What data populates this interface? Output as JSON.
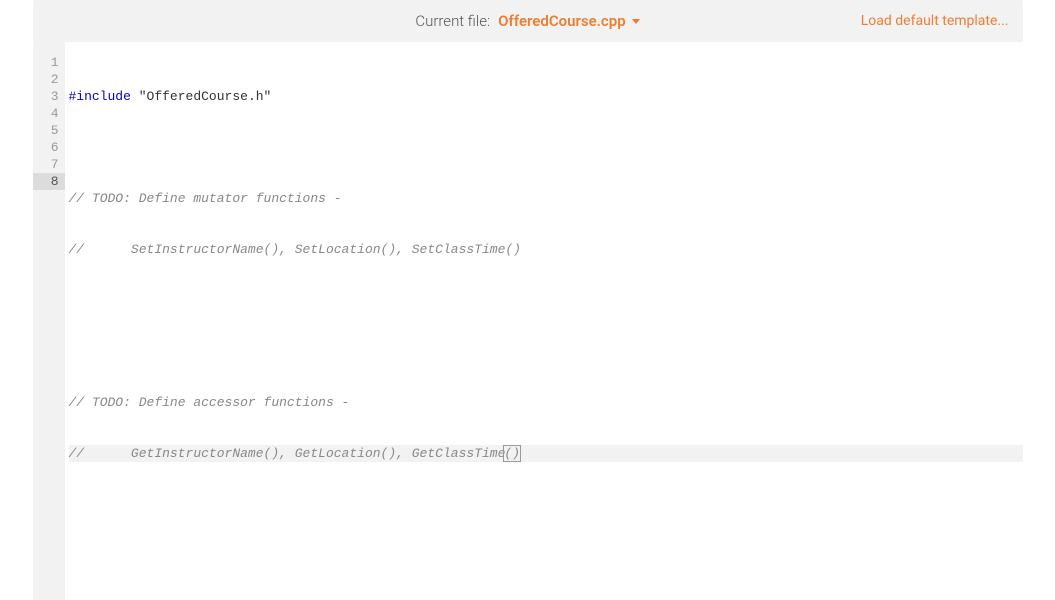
{
  "header": {
    "current_file_label": "Current file:",
    "filename": "OfferedCourse.cpp",
    "load_template_label": "Load default template..."
  },
  "gutter": {
    "lines": [
      "1",
      "2",
      "3",
      "4",
      "5",
      "6",
      "7",
      "8"
    ],
    "current_line_index": 7
  },
  "code": {
    "line1_keyword": "#include",
    "line1_rest": " \"OfferedCourse.h\"",
    "line2": "",
    "line3": "// TODO: Define mutator functions -",
    "line4": "//      SetInstructorName(), SetLocation(), SetClassTime()",
    "line5": "",
    "line6": "",
    "line7": "// TODO: Define accessor functions -",
    "line8_a": "//      GetInstructorName(), GetLocation(), GetClassTime",
    "line8_b": "()"
  }
}
